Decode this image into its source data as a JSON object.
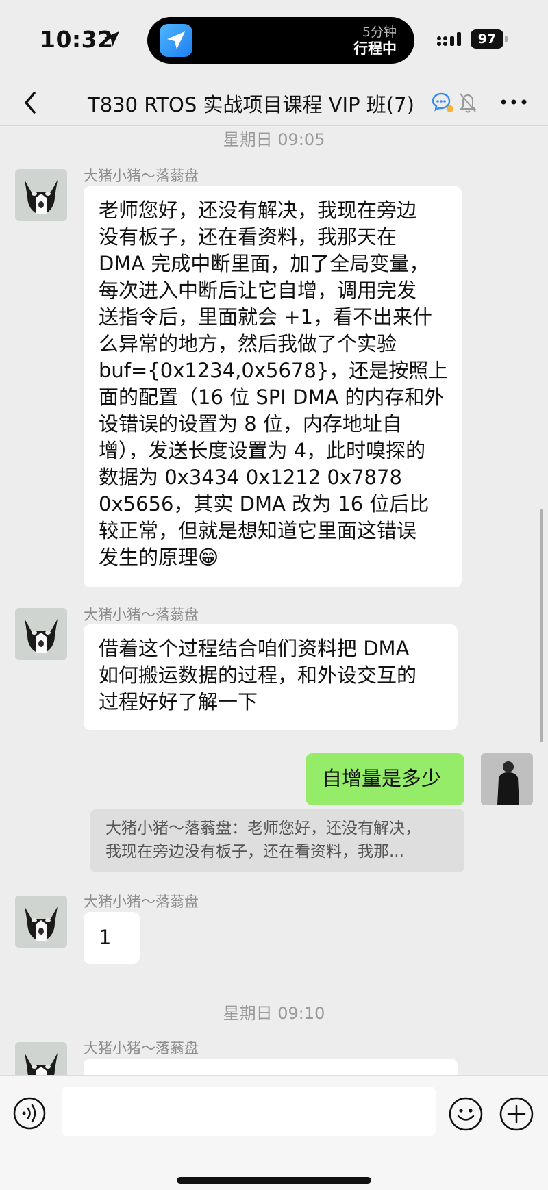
{
  "status_bar": {
    "time": "10:32",
    "island_sub": "5分钟",
    "island_main": "行程中",
    "battery": "97"
  },
  "nav": {
    "title": "T830 RTOS 实战项目课程 VIP 班(7)"
  },
  "chat": {
    "timestamp_1": "星期日 09:05",
    "msg1": {
      "sender": "大猪小猪～落蓊盘",
      "lines": [
        "老师您好，还没有解决，我现在旁边",
        "没有板子，还在看资料，我那天在",
        "DMA 完成中断里面，加了全局变量，",
        "每次进入中断后让它自增，调用完发",
        "送指令后，里面就会 +1，看不出来什",
        "么异常的地方，然后我做了个实验",
        "buf={0x1234,0x5678}，还是按照上",
        "面的配置（16 位 SPI DMA 的内存和外",
        "设错误的设置为 8 位，内存地址自",
        "增），发送长度设置为 4，此时嗅探的",
        "数据为 0x3434 0x1212 0x7878",
        "0x5656，其实 DMA 改为 16 位后比",
        "较正常，但就是想知道它里面这错误",
        "发生的原理😁"
      ]
    },
    "msg2": {
      "sender": "大猪小猪～落蓊盘",
      "lines": [
        "借着这个过程结合咱们资料把 DMA",
        "如何搬运数据的过程，和外设交互的",
        "过程好好了解一下"
      ]
    },
    "msg3": {
      "text": "自增量是多少",
      "quote_lines": [
        "大猪小猪～落蓊盘：老师您好，还没有解决，",
        "我现在旁边没有板子，还在看资料，我那..."
      ]
    },
    "msg4": {
      "sender": "大猪小猪～落蓊盘",
      "text": "1"
    },
    "timestamp_2": "星期日 09:10",
    "msg5": {
      "sender": "大猪小猪～落蓊盘"
    }
  },
  "input": {
    "placeholder": ""
  },
  "icons": {
    "back": "chevron-left-icon",
    "more": "more-dots-icon",
    "voice": "voice-icon",
    "emoji": "emoji-icon",
    "plus": "plus-icon"
  }
}
